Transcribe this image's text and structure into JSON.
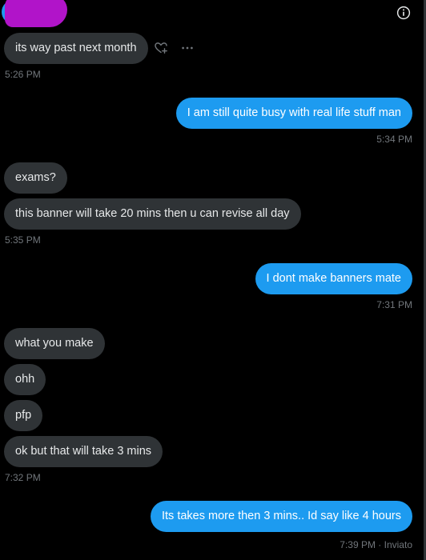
{
  "conversation": {
    "messages": [
      {
        "side": "received",
        "text": "its way past next month"
      },
      {
        "side": "sent",
        "text": "I am still quite busy with real life stuff man"
      },
      {
        "side": "received",
        "text": "exams?"
      },
      {
        "side": "received",
        "text": "this banner will take 20 mins then u can revise all day"
      },
      {
        "side": "sent",
        "text": "I dont make banners mate"
      },
      {
        "side": "received",
        "text": "what you make"
      },
      {
        "side": "received",
        "text": "ohh"
      },
      {
        "side": "received",
        "text": "pfp"
      },
      {
        "side": "received",
        "text": "ok but that will take 3 mins"
      },
      {
        "side": "sent",
        "text": "Its takes more then 3 mins.. Id say like 4 hours"
      }
    ],
    "timestamps": [
      "5:26 PM",
      "5:34 PM",
      "5:35 PM",
      "7:31 PM",
      "7:32 PM",
      "7:39 PM · Inviato"
    ]
  },
  "icons": {
    "info": "info-circle-icon",
    "react": "heart-plus-icon",
    "more": "more-horizontal-icon"
  },
  "colors": {
    "background": "#000000",
    "received_bubble": "#2f3336",
    "sent_bubble": "#1d9bf0",
    "timestamp": "#71767b",
    "redaction": "#b114c9"
  }
}
